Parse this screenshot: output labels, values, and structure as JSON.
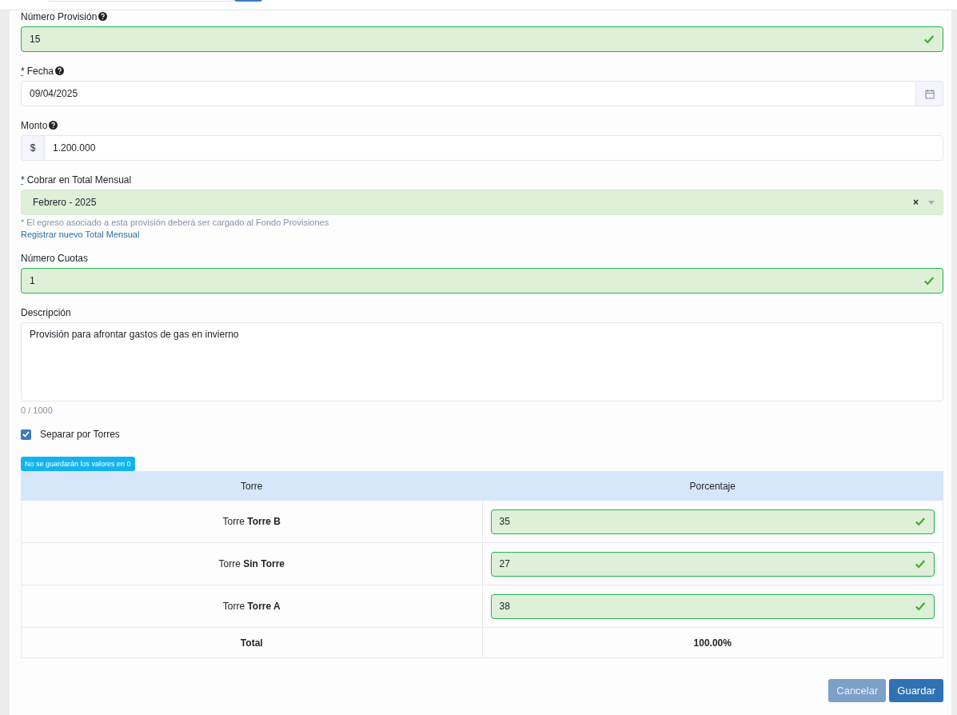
{
  "fields": [
    {
      "kind": "text",
      "label": "Número Provisión",
      "help": true,
      "value": "15",
      "valid": true
    },
    {
      "kind": "date",
      "required_mark": "*",
      "label": "Fecha",
      "help": true,
      "value": "09/04/2025",
      "valid": false
    },
    {
      "kind": "currency",
      "label": "Monto",
      "help": true,
      "prefix": "$",
      "value": "1.200.000",
      "valid": false
    },
    {
      "kind": "select",
      "required_mark": "*",
      "label": "Cobrar en Total Mensual",
      "help": false,
      "value": "Febrero - 2025",
      "valid": true,
      "clear": "×",
      "note": "* El egreso asociado a esta provisión deberá ser cargado al Fondo Provisiones",
      "link": "Registrar nuevo Total Mensual"
    },
    {
      "kind": "text",
      "label": "Número Cuotas",
      "help": false,
      "value": "1",
      "valid": true
    },
    {
      "kind": "textarea",
      "label": "Descripción",
      "help": false,
      "value": "Provisión para afrontar gastos de gas en invierno",
      "valid": false,
      "counter": "0 / 1000"
    }
  ],
  "split": {
    "label": "Separar por Torres",
    "checked": true
  },
  "notice": "No se guardarán los valores en 0",
  "table": {
    "columns": [
      "Torre",
      "Porcentaje"
    ],
    "rows": [
      {
        "torre": "Torre **Torre B**",
        "value": "35",
        "valid": true
      },
      {
        "torre": "Torre **Sin Torre**",
        "value": "27",
        "valid": true
      },
      {
        "torre": "Torre **Torre A**",
        "value": "38",
        "valid": true
      }
    ],
    "total_label": "Total",
    "total": "100.00%"
  },
  "buttons": [
    {
      "label": "Cancelar",
      "kind": "secondary"
    },
    {
      "label": "Guardar",
      "kind": "primary"
    }
  ]
}
